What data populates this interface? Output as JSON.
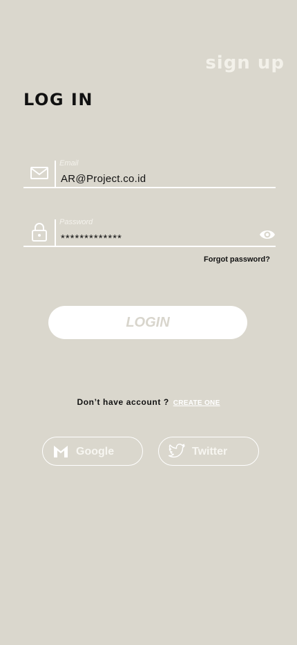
{
  "header": {
    "signup_label": "sign up",
    "title": "LOG IN"
  },
  "form": {
    "email": {
      "label": "Email",
      "value": "AR@Project.co.id",
      "icon": "mail-icon"
    },
    "password": {
      "label": "Password",
      "value": "*************",
      "icon": "lock-icon",
      "toggle_icon": "eye-icon"
    },
    "forgot_label": "Forgot password?",
    "login_label": "LOGIN"
  },
  "signup_prompt": {
    "text": "Don’t have account ?",
    "link": "CREATE ONE"
  },
  "social": {
    "google_label": "Google",
    "google_icon": "gmail-icon",
    "twitter_label": "Twitter",
    "twitter_icon": "twitter-bird-icon"
  },
  "colors": {
    "background": "#dad7cd",
    "accent": "#ffffff",
    "text": "#111111"
  }
}
